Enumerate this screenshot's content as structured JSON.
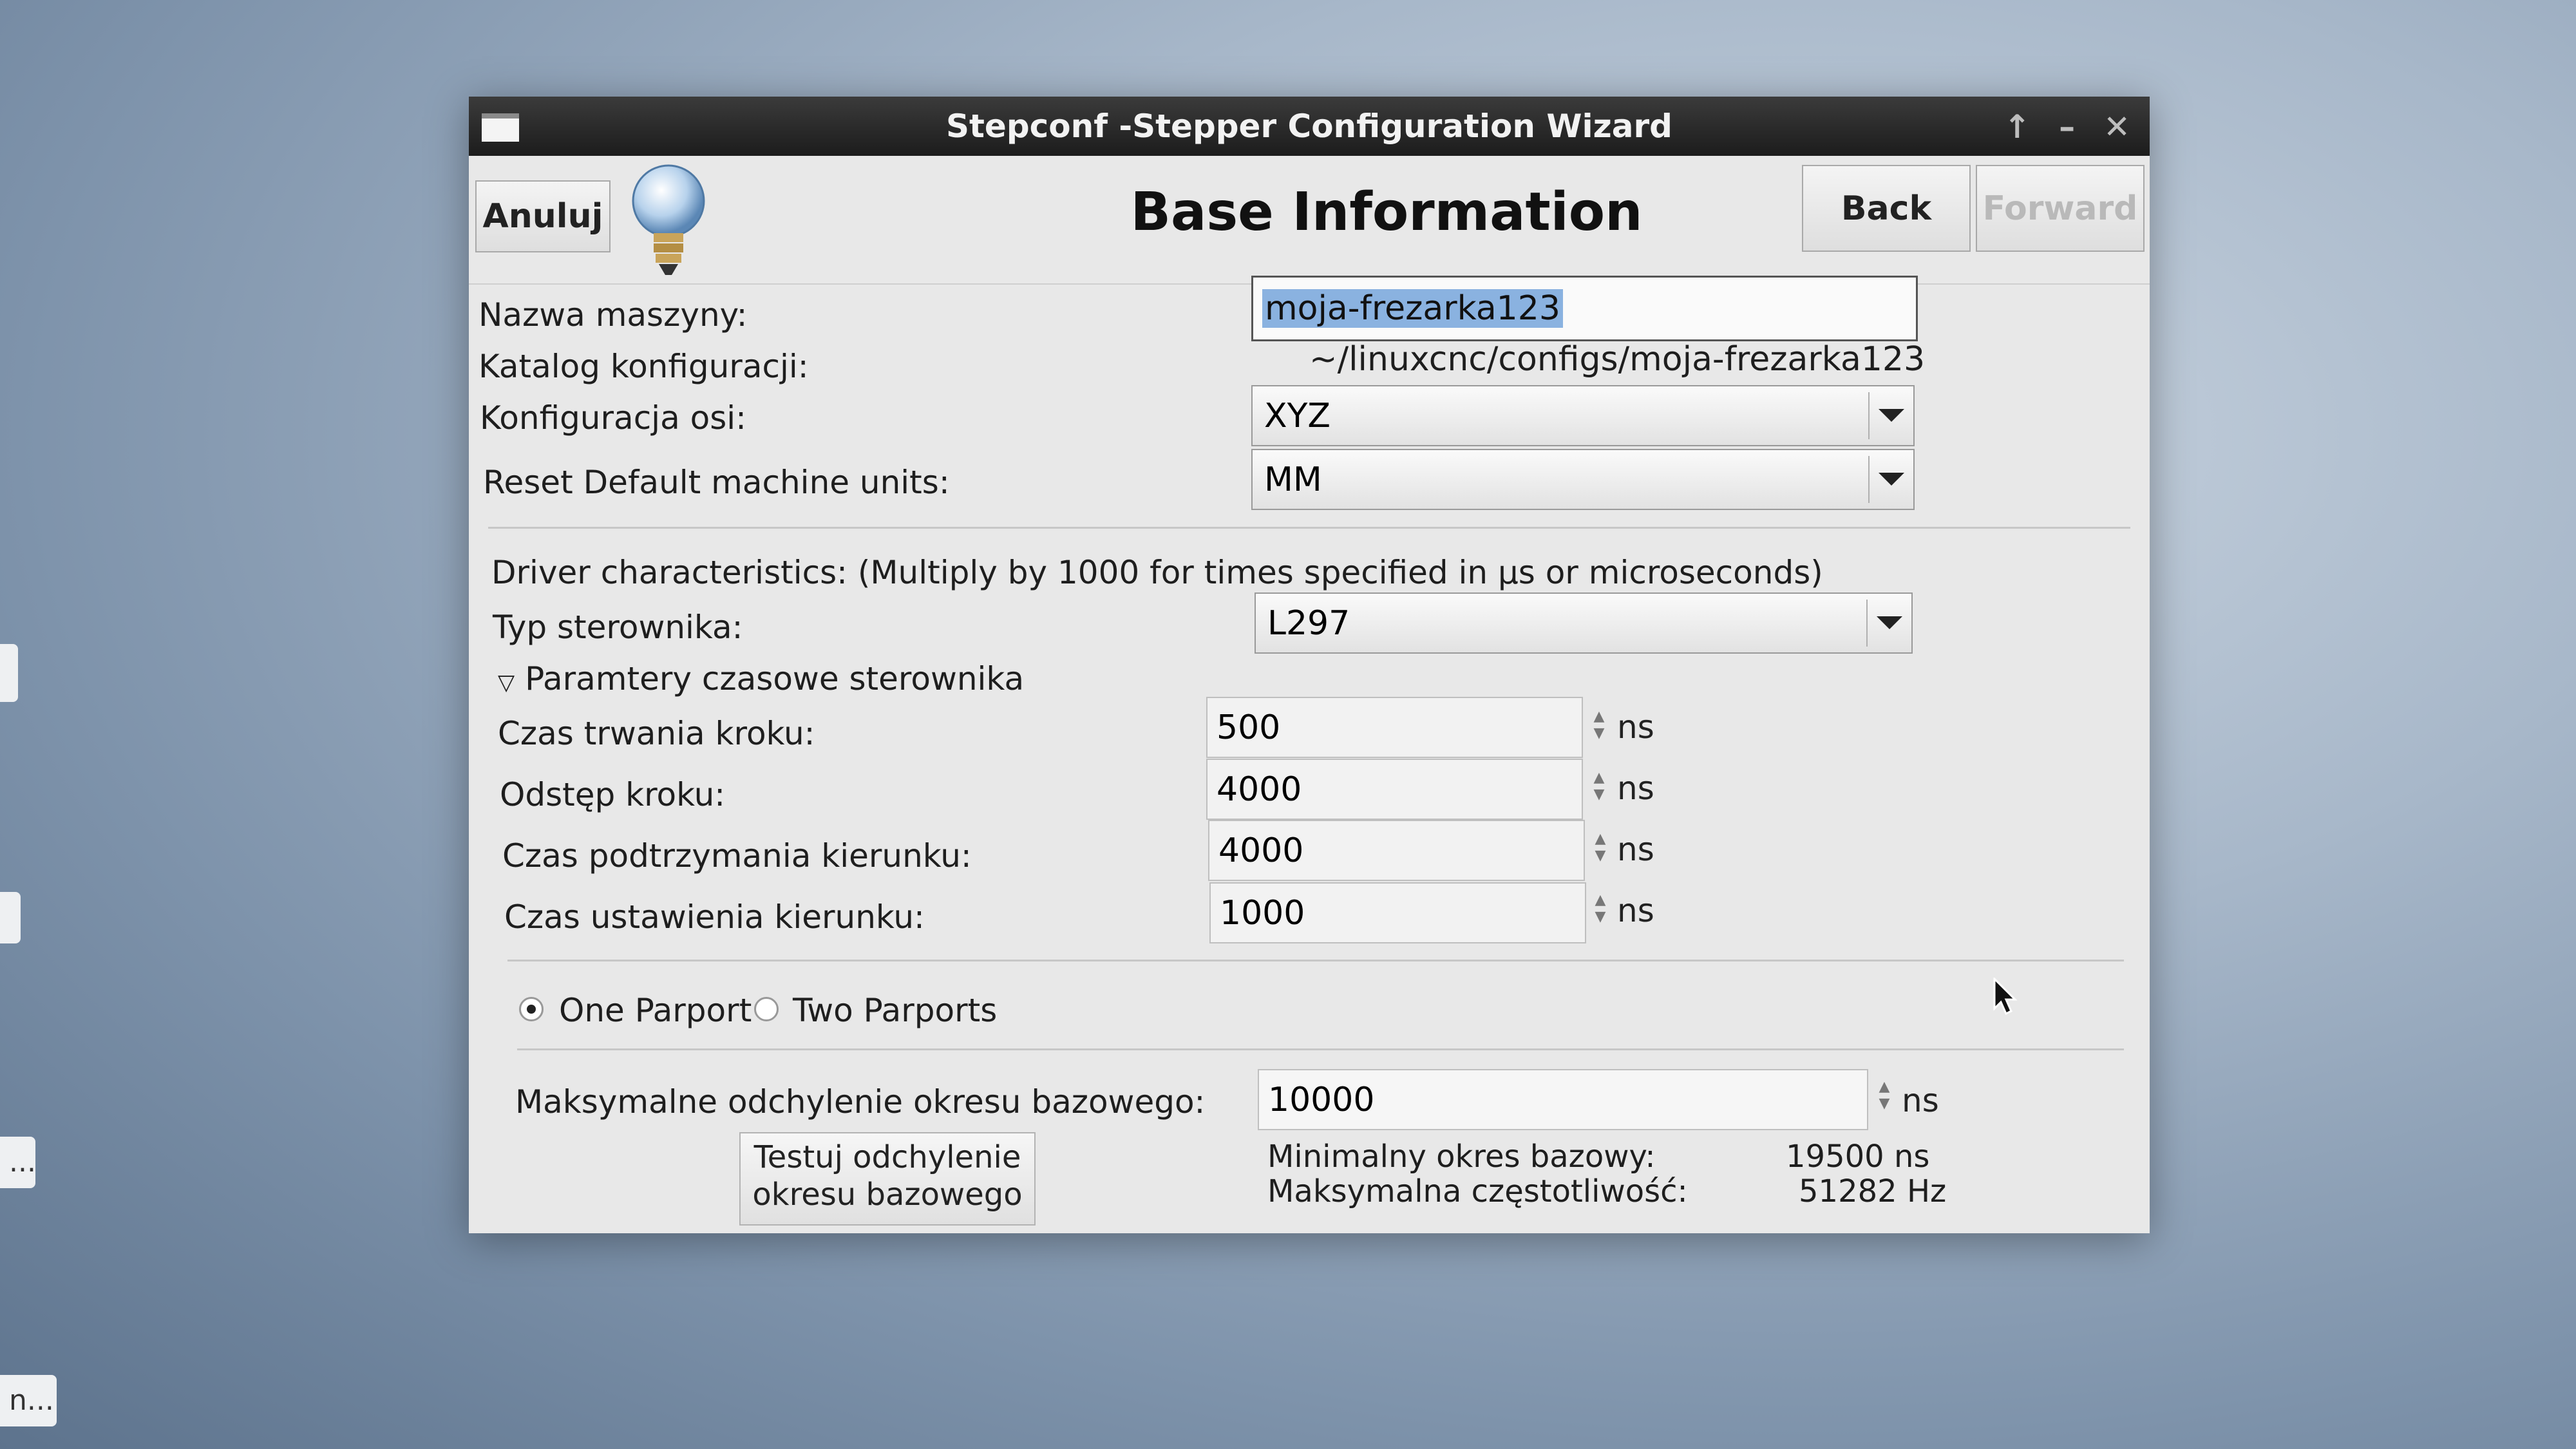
{
  "window": {
    "title": "Stepconf -Stepper Configuration Wizard"
  },
  "header": {
    "cancel_label": "Anuluj",
    "page_title": "Base Information",
    "back_label": "Back",
    "forward_label": "Forward"
  },
  "machine": {
    "name_label": "Nazwa maszyny:",
    "name_value": "moja-frezarka123",
    "config_dir_label": "Katalog konfiguracji:",
    "config_dir_value": "~/linuxcnc/configs/moja-frezarka123",
    "axis_label": "Konfiguracja osi:",
    "axis_value": "XYZ",
    "units_label": "Reset Default machine units:",
    "units_value": "MM"
  },
  "driver": {
    "heading": "Driver characteristics: (Multiply by 1000 for times specified in µs or microseconds)",
    "type_label": "Typ sterownika:",
    "type_value": "L297",
    "timing_expander": "Paramtery czasowe sterownika",
    "step_time_label": "Czas trwania kroku:",
    "step_time_value": "500",
    "step_space_label": "Odstęp kroku:",
    "step_space_value": "4000",
    "dir_hold_label": "Czas podtrzymania kierunku:",
    "dir_hold_value": "4000",
    "dir_setup_label": "Czas ustawienia kierunku:",
    "dir_setup_value": "1000",
    "unit": "ns"
  },
  "parport": {
    "one_label": "One Parport",
    "two_label": "Two Parports",
    "selected": "one"
  },
  "latency": {
    "max_jitter_label": "Maksymalne odchylenie okresu bazowego:",
    "max_jitter_value": "10000",
    "unit": "ns",
    "test_button": "Testuj odchylenie okresu bazowego",
    "min_base_label": "Minimalny okres bazowy:",
    "min_base_value": "19500 ns",
    "max_freq_label": "Maksymalna częstotliwość:",
    "max_freq_value": "51282 Hz"
  },
  "desktop": {
    "tab3_text": "...",
    "tab4_text": "n..."
  },
  "icons": [
    "window-menu-icon",
    "maximize-icon",
    "minimize-icon",
    "close-icon",
    "lightbulb-icon",
    "dropdown-arrow-icon",
    "mouse-cursor-icon"
  ],
  "colors": {
    "selection": "#8ab2e0",
    "titlebar": "#1c1c1c"
  }
}
